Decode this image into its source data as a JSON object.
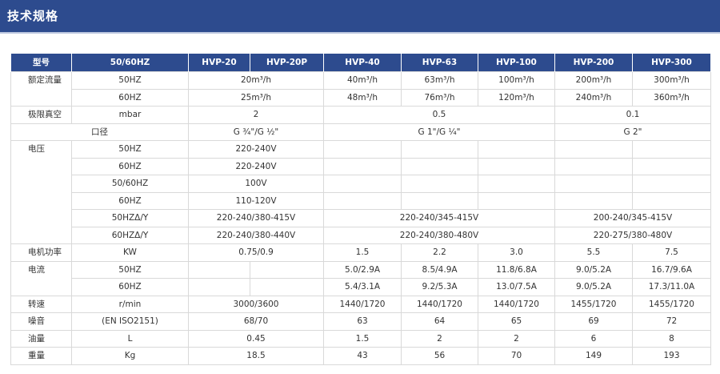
{
  "section_title": "技术规格",
  "header": {
    "model": "型号",
    "freq": "50/60HZ",
    "models": [
      "HVP-20",
      "HVP-20P",
      "HVP-40",
      "HVP-63",
      "HVP-100",
      "HVP-200",
      "HVP-300"
    ]
  },
  "flow": {
    "label": "额定流量",
    "r50": {
      "unit": "50HZ",
      "hvp20": "20m³/h",
      "hvp40": "40m³/h",
      "hvp63": "63m³/h",
      "hvp100": "100m³/h",
      "hvp200": "200m³/h",
      "hvp300": "300m³/h"
    },
    "r60": {
      "unit": "60HZ",
      "hvp20": "25m³/h",
      "hvp40": "48m³/h",
      "hvp63": "76m³/h",
      "hvp100": "120m³/h",
      "hvp200": "240m³/h",
      "hvp300": "360m³/h"
    }
  },
  "vacuum": {
    "label": "极限真空",
    "unit": "mbar",
    "v1": "2",
    "v2": "0.5",
    "v3": "0.1"
  },
  "port": {
    "label": "口径",
    "v1": "G ¾\"/G ½\"",
    "v2": "G 1\"/G ¼\"",
    "v3": "G 2\""
  },
  "voltage": {
    "label": "电压",
    "r1": {
      "unit": "50HZ",
      "v": "220-240V"
    },
    "r2": {
      "unit": "60HZ",
      "v": "220-240V"
    },
    "r3": {
      "unit": "50/60HZ",
      "v": "100V"
    },
    "r4": {
      "unit": "60HZ",
      "v": "110-120V"
    },
    "r5": {
      "unit": "50HZΔ/Y",
      "v1": "220-240/380-415V",
      "v2": "220-240/345-415V",
      "v3": "200-240/345-415V"
    },
    "r6": {
      "unit": "60HZΔ/Y",
      "v1": "220-240/380-440V",
      "v2": "220-240/380-480V",
      "v3": "220-275/380-480V"
    }
  },
  "power": {
    "label": "电机功率",
    "unit": "KW",
    "hvp20": "0.75/0.9",
    "hvp40": "1.5",
    "hvp63": "2.2",
    "hvp100": "3.0",
    "hvp200": "5.5",
    "hvp300": "7.5"
  },
  "current": {
    "label": "电流",
    "r50": {
      "unit": "50HZ",
      "hvp40": "5.0/2.9A",
      "hvp63": "8.5/4.9A",
      "hvp100": "11.8/6.8A",
      "hvp200": "9.0/5.2A",
      "hvp300": "16.7/9.6A"
    },
    "r60": {
      "unit": "60HZ",
      "hvp40": "5.4/3.1A",
      "hvp63": "9.2/5.3A",
      "hvp100": "13.0/7.5A",
      "hvp200": "9.0/5.2A",
      "hvp300": "17.3/11.0A"
    }
  },
  "speed": {
    "label": "转速",
    "unit": "r/min",
    "hvp20": "3000/3600",
    "hvp40": "1440/1720",
    "hvp63": "1440/1720",
    "hvp100": "1440/1720",
    "hvp200": "1455/1720",
    "hvp300": "1455/1720"
  },
  "noise": {
    "label": "噪音",
    "unit": "(EN ISO2151)",
    "hvp20": "68/70",
    "hvp40": "63",
    "hvp63": "64",
    "hvp100": "65",
    "hvp200": "69",
    "hvp300": "72"
  },
  "oil": {
    "label": "油量",
    "unit": "L",
    "hvp20": "0.45",
    "hvp40": "1.5",
    "hvp63": "2",
    "hvp100": "2",
    "hvp200": "6",
    "hvp300": "8"
  },
  "weight": {
    "label": "重量",
    "unit": "Kg",
    "hvp20": "18.5",
    "hvp40": "43",
    "hvp63": "56",
    "hvp100": "70",
    "hvp200": "149",
    "hvp300": "193"
  }
}
